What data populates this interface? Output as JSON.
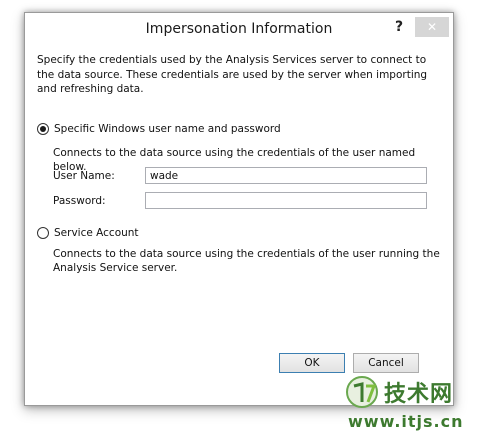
{
  "dialog": {
    "title": "Impersonation Information",
    "help_glyph": "?",
    "close_glyph": "✕"
  },
  "description": "Specify the credentials used by the Analysis Services server to connect to the data source. These credentials are used by the server when importing and refreshing data.",
  "option_windows": {
    "label": "Specific Windows user name and password",
    "selected": true,
    "description": "Connects to the data source using the credentials of the user named below."
  },
  "fields": {
    "username_label": "User Name:",
    "username_value": "wade",
    "password_label": "Password:",
    "password_value": ""
  },
  "option_service": {
    "label": "Service Account",
    "selected": false,
    "description": "Connects to the data source using the credentials of the user running the Analysis Service server."
  },
  "buttons": {
    "ok": "OK",
    "cancel": "Cancel"
  },
  "watermark": {
    "brand": "技术网",
    "url": "www.itjs.cn",
    "color": "#3d7a2f"
  }
}
